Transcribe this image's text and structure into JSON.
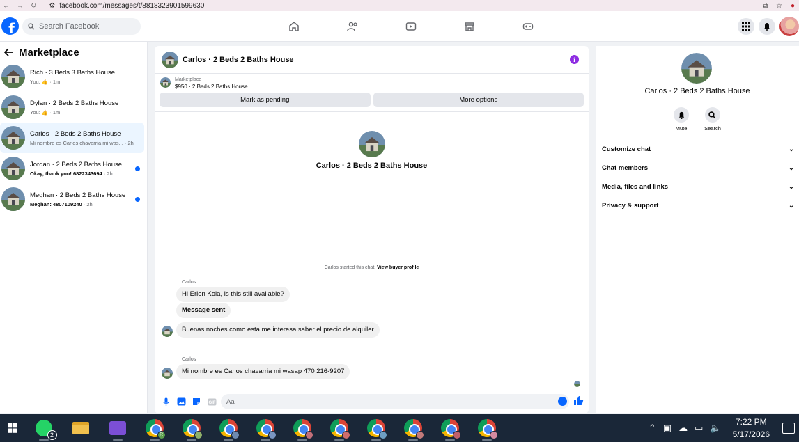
{
  "browser": {
    "url": "facebook.com/messages/t/8818323901599630"
  },
  "header": {
    "search_placeholder": "Search Facebook"
  },
  "left": {
    "title": "Marketplace",
    "conversations": [
      {
        "name": "Rich · 3 Beds 3 Baths House",
        "preview": "You:",
        "time": "· 1m",
        "like_icon": "thumbs-up-icon",
        "unread": false,
        "active": false
      },
      {
        "name": "Dylan · 2 Beds 2 Baths House",
        "preview": "You:",
        "time": "· 1m",
        "like_icon": "thumbs-up-icon",
        "unread": false,
        "active": false
      },
      {
        "name": "Carlos · 2 Beds 2 Baths House",
        "preview": "Mi nombre es Carlos chavarria mi was...",
        "time": "· 2h",
        "unread": false,
        "active": true
      },
      {
        "name": "Jordan · 2 Beds 2 Baths House",
        "preview": "Okay, thank you! 6822343694",
        "time": "· 2h",
        "unread": true,
        "active": false
      },
      {
        "name": "Meghan · 2 Beds 2 Baths House",
        "preview": "Meghan: 4807109240",
        "time": "· 2h",
        "unread": true,
        "active": false
      }
    ]
  },
  "chat": {
    "title": "Carlos · 2 Beds 2 Baths House",
    "marketplace_label": "Marketplace",
    "listing": "$950 · 2 Beds 2 Baths House",
    "mark_pending": "Mark as pending",
    "more_options": "More options",
    "profile_name": "Carlos · 2 Beds 2 Baths House",
    "started_text": "Carlos started this chat.",
    "view_buyer": "View buyer profile",
    "messages": [
      {
        "sender": "Carlos",
        "text": "Hi Erion Kola, is this still available?"
      },
      {
        "text": "Message sent"
      },
      {
        "text": "Buenas noches como esta me interesa saber el precio de alquiler"
      },
      {
        "sender": "Carlos",
        "text": "Mi nombre es Carlos chavarria mi wasap 470 216-9207"
      }
    ],
    "composer_placeholder": "Aa"
  },
  "right": {
    "name": "Carlos · 2 Beds 2 Baths House",
    "mute": "Mute",
    "search": "Search",
    "sections": [
      "Customize chat",
      "Chat members",
      "Media, files and links",
      "Privacy & support"
    ]
  },
  "taskbar": {
    "whatsapp_badge": "2",
    "time": "7:22 PM",
    "date": "5/17/2026"
  },
  "colors": {
    "accent": "#0866ff",
    "info": "#8e2de2"
  }
}
